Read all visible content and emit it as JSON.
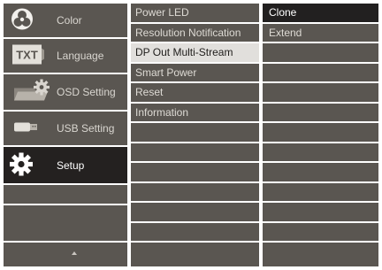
{
  "main_menu": {
    "items": [
      {
        "label": "Color",
        "icon": "color-icon"
      },
      {
        "label": "Language",
        "icon": "language-icon",
        "icon_text": "TXT"
      },
      {
        "label": "OSD Setting",
        "icon": "osd-setting-icon"
      },
      {
        "label": "USB Setting",
        "icon": "usb-setting-icon"
      },
      {
        "label": "Setup",
        "icon": "gear-icon",
        "selected": true
      }
    ],
    "scroll_up_icon": "up-arrow-icon"
  },
  "setup_menu": {
    "items": [
      {
        "label": "Power LED"
      },
      {
        "label": "Resolution Notification"
      },
      {
        "label": "DP Out Multi-Stream",
        "selected": true
      },
      {
        "label": "Smart Power"
      },
      {
        "label": "Reset"
      },
      {
        "label": "Information"
      }
    ]
  },
  "options": {
    "items": [
      {
        "label": "Clone",
        "selected": true
      },
      {
        "label": "Extend"
      }
    ]
  },
  "colors": {
    "panel": "#5a5651",
    "active_main": "#242120",
    "active_sub": "#e1dfdc",
    "active_option": "#222020",
    "separator": "#ffffff"
  }
}
